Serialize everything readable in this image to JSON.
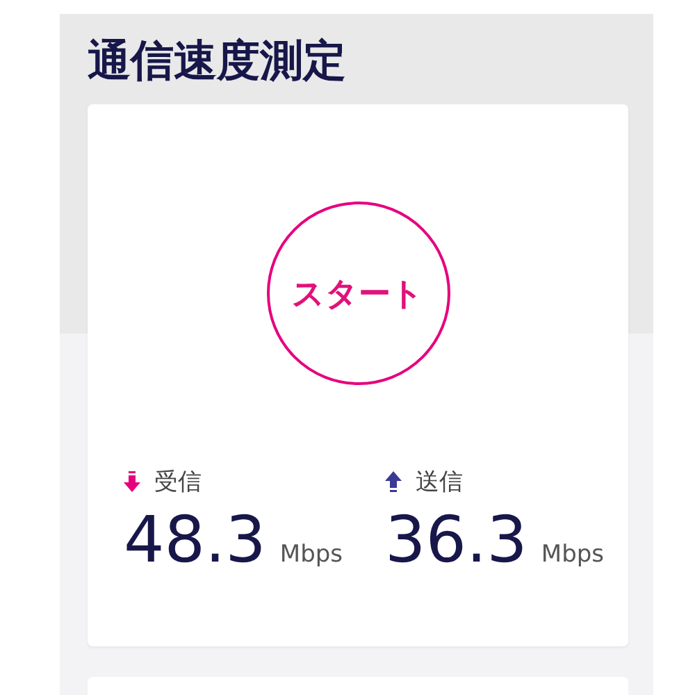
{
  "title": "通信速度測定",
  "start_button": {
    "label": "スタート"
  },
  "results": [
    {
      "kind": "download",
      "label": "受信",
      "value": "48.3",
      "unit": "Mbps"
    },
    {
      "kind": "upload",
      "label": "送信",
      "value": "36.3",
      "unit": "Mbps"
    }
  ]
}
